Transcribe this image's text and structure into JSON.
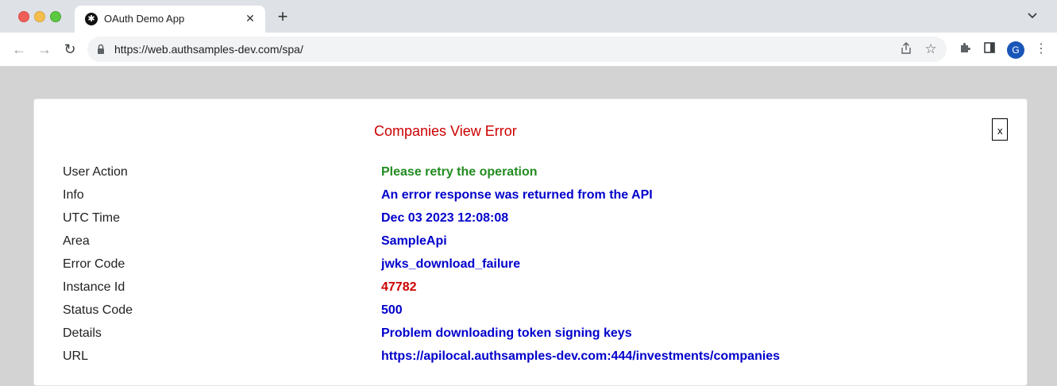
{
  "browser": {
    "tab_title": "OAuth Demo App",
    "tab_favicon": "gear-icon",
    "new_tab_symbol": "+",
    "tab_close_symbol": "✕",
    "url": "https://web.authsamples-dev.com/spa/",
    "avatar_initial": "G"
  },
  "dialog": {
    "title": "Companies View Error",
    "close_label": "x",
    "title_color": "#cc0000",
    "rows": [
      {
        "label": "User Action",
        "value": "Please retry the operation",
        "color": "#228b22"
      },
      {
        "label": "Info",
        "value": "An error response was returned from the API",
        "color": "#0000cc"
      },
      {
        "label": "UTC Time",
        "value": "Dec 03 2023 12:08:08",
        "color": "#0000cc"
      },
      {
        "label": "Area",
        "value": "SampleApi",
        "color": "#0000cc"
      },
      {
        "label": "Error Code",
        "value": "jwks_download_failure",
        "color": "#0000cc"
      },
      {
        "label": "Instance Id",
        "value": "47782",
        "color": "#cc0000"
      },
      {
        "label": "Status Code",
        "value": "500",
        "color": "#0000cc"
      },
      {
        "label": "Details",
        "value": "Problem downloading token signing keys",
        "color": "#0000cc"
      },
      {
        "label": "URL",
        "value": "https://apilocal.authsamples-dev.com:444/investments/companies",
        "color": "#0000cc"
      }
    ]
  }
}
